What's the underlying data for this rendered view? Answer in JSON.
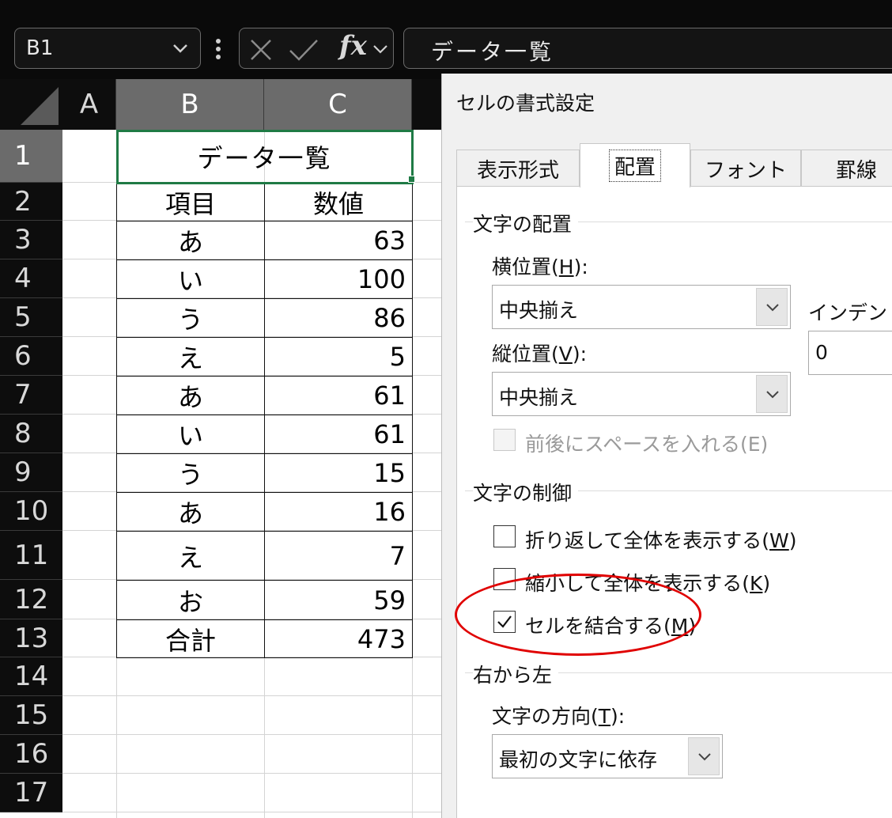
{
  "formula_bar": {
    "name_box": "B1",
    "fx_label": "fx",
    "formula": "データ一覧"
  },
  "columns": [
    "A",
    "B",
    "C"
  ],
  "rows": [
    "1",
    "2",
    "3",
    "4",
    "5",
    "6",
    "7",
    "8",
    "9",
    "10",
    "11",
    "12",
    "13",
    "14",
    "15",
    "16",
    "17"
  ],
  "table": {
    "title": "データ一覧",
    "header": [
      "項目",
      "数値"
    ],
    "rows": [
      [
        "あ",
        "63"
      ],
      [
        "い",
        "100"
      ],
      [
        "う",
        "86"
      ],
      [
        "え",
        "5"
      ],
      [
        "あ",
        "61"
      ],
      [
        "い",
        "61"
      ],
      [
        "う",
        "15"
      ],
      [
        "あ",
        "16"
      ],
      [
        "え",
        "7"
      ],
      [
        "お",
        "59"
      ]
    ],
    "total": [
      "合計",
      "473"
    ]
  },
  "dialog": {
    "title": "セルの書式設定",
    "tabs": [
      "表示形式",
      "配置",
      "フォント",
      "罫線"
    ],
    "active_tab": "配置",
    "text_alignment": {
      "group_label": "文字の配置",
      "horizontal_label": "横位置(",
      "horizontal_key": "H",
      "horizontal_label_end": "):",
      "horizontal_value": "中央揃え",
      "vertical_label": "縦位置(",
      "vertical_key": "V",
      "vertical_label_end": "):",
      "vertical_value": "中央揃え",
      "indent_label": "インデント(",
      "indent_value": "0",
      "justify_distributed": "前後にスペースを入れる(E)"
    },
    "text_control": {
      "group_label": "文字の制御",
      "wrap_text": "折り返して全体を表示する(",
      "wrap_key": "W",
      "wrap_checked": false,
      "shrink_to_fit": "縮小して全体を表示する(",
      "shrink_key": "K",
      "shrink_checked": false,
      "merge_cells": "セルを結合する(",
      "merge_key": "M",
      "merge_checked": true,
      "close_paren": ")"
    },
    "rtl": {
      "group_label": "右から左",
      "direction_label": "文字の方向(",
      "direction_key": "T",
      "direction_label_end": "):",
      "direction_value": "最初の文字に依存"
    }
  },
  "colors": {
    "highlight": "#e00000",
    "selection": "#1f7a45"
  }
}
